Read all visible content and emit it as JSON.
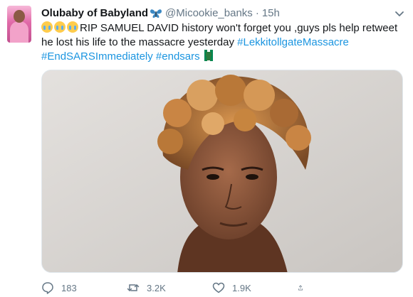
{
  "tweet": {
    "display_name": "Olubaby of Babyland",
    "badge_icon": "butterfly-icon",
    "handle": "@Micookie_banks",
    "separator": "·",
    "time": "15h",
    "text_plain_1": "RIP SAMUEL DAVID history won't forget you ,guys pls help retweet he lost his life to the massacre yesterday ",
    "hashtag_1": "#LekkitollgateMassacre",
    "hashtag_2": "#EndSARSImmediately",
    "hashtag_3": "#endsars",
    "emoji_icon": "crying-face-icon",
    "fist_icon": "raised-fist-icon"
  },
  "actions": {
    "reply_count": "183",
    "retweet_count": "3.2K",
    "like_count": "1.9K"
  },
  "colors": {
    "link": "#1b95e0",
    "muted": "#657786",
    "text": "#14171a"
  }
}
